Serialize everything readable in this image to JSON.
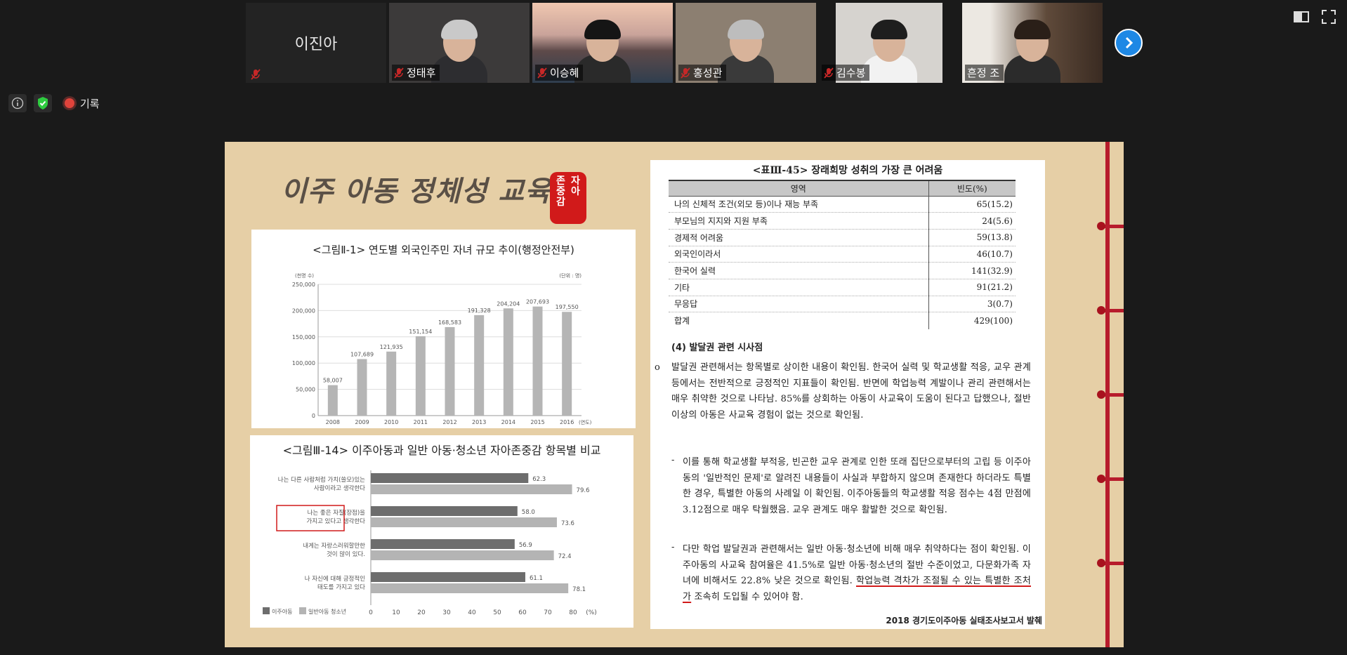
{
  "participants": [
    {
      "name": "이진아",
      "video": false,
      "muted": true
    },
    {
      "name": "정태후",
      "video": true,
      "muted": true,
      "bg": "#3c3a3a",
      "hair": "#c9c9c9"
    },
    {
      "name": "이승혜",
      "video": true,
      "muted": true,
      "bg": "#6a7a8a",
      "hair": "#151515"
    },
    {
      "name": "홍성관",
      "video": true,
      "muted": true,
      "bg": "#8c7f71",
      "hair": "#bdbdbd"
    },
    {
      "name": "김수봉",
      "video": true,
      "muted": true,
      "bg": "#d6d3cf",
      "hair": "#1e1e1e"
    },
    {
      "name": "흔정 조",
      "video": true,
      "muted": false,
      "bg": "#5f4a3a",
      "hair": "#2a1f18",
      "active": true
    }
  ],
  "status": {
    "record_label": "기록"
  },
  "slide": {
    "title": "이주 아동 정체성 교육",
    "seal_col1": [
      "존",
      "중",
      "감"
    ],
    "seal_col2": [
      "자",
      "아"
    ],
    "source": "2018 경기도이주아동 실태조사보고서 발췌"
  },
  "chart_data": [
    {
      "type": "bar",
      "title": "<그림Ⅱ-1> 연도별 외국인주민 자녀 규모 추이(행정안전부)",
      "ylabel": "(천명 수)",
      "unit_label": "(단위 : 명)",
      "xlabel": "(연도)",
      "categories": [
        "2008",
        "2009",
        "2010",
        "2011",
        "2012",
        "2013",
        "2014",
        "2015",
        "2016"
      ],
      "values": [
        58007,
        107689,
        121935,
        151154,
        168583,
        191328,
        204204,
        207693,
        197550
      ],
      "data_labels": [
        "58,007",
        "107,689",
        "121,935",
        "151,154",
        "168,583",
        "191,328",
        "204,204",
        "207,693",
        "197,550"
      ],
      "ylim": [
        0,
        250000
      ],
      "yticks": [
        "0",
        "50,000",
        "100,000",
        "150,000",
        "200,000",
        "250,000"
      ],
      "color": "#b5b5b5"
    },
    {
      "type": "bar",
      "orientation": "horizontal",
      "title": "<그림Ⅲ-14> 이주아동과 일반 아동·청소년 자아존중감 항목별 비교",
      "categories": [
        [
          "나는 다른 사람처럼 가치(쓸모)있는",
          "사람이라고 생각한다"
        ],
        [
          "나는 좋은 자질(장점)을",
          "가지고 있다고 생각한다"
        ],
        [
          "내게는 자랑스러워할만한",
          "것이 많이 있다."
        ],
        [
          "나 자신에 대해 긍정적인",
          "태도를 가지고 있다"
        ]
      ],
      "series": [
        {
          "name": "이주아동",
          "values": [
            62.3,
            58.0,
            56.9,
            61.1
          ],
          "color": "#6d6d6d"
        },
        {
          "name": "일반아동 청소년",
          "values": [
            79.6,
            73.6,
            72.4,
            78.1
          ],
          "color": "#b4b4b4"
        }
      ],
      "xlim": [
        0,
        80
      ],
      "xticks": [
        "0",
        "10",
        "20",
        "30",
        "40",
        "50",
        "60",
        "70",
        "80"
      ],
      "unit": "(%)",
      "highlighted_category": 1
    }
  ],
  "table": {
    "title": "<표Ⅲ-45> 장래희망 성취의 가장 큰 어려움",
    "headers": [
      "영역",
      "빈도(%)"
    ],
    "rows": [
      [
        "나의 신체적 조건(외모 등)이나 재능 부족",
        "65(15.2)"
      ],
      [
        "부모님의 지지와 지원 부족",
        "24(5.6)"
      ],
      [
        "경제적 어려움",
        "59(13.8)"
      ],
      [
        "외국인이라서",
        "46(10.7)"
      ],
      [
        "한국어 실력",
        "141(32.9)"
      ],
      [
        "기타",
        "91(21.2)"
      ],
      [
        "무응답",
        "3(0.7)"
      ],
      [
        "합계",
        "429(100)"
      ]
    ]
  },
  "text": {
    "section": "(4) 발달권 관련 시사점",
    "bullet": "o",
    "p1": "발달권 관련해서는 항목별로 상이한 내용이 확인됨. 한국어 실력 및 학교생활 적응, 교우 관계 등에서는 전반적으로 긍정적인 지표들이 확인됨. 반면에 학업능력 계발이나 관리 관련해서는 매우 취약한 것으로 나타남. 85%를 상회하는 아동이 사교육이 도움이 된다고 답했으나, 절반 이상의 아동은 사교육 경험이 없는 것으로 확인됨.",
    "dash": "-",
    "p2": "이를 통해 학교생활 부적응, 빈곤한 교우 관계로 인한 또래 집단으로부터의 고립 등 이주아동의 '일반적인 문제'로 알려진 내용들이 사실과 부합하지 않으며 존재한다 하더라도 특별한 경우, 특별한 아동의 사례일 이 확인됨. 이주아동들의 학교생활 적응 점수는 4점 만점에 3.12점으로 매우 탁월했음. 교우 관계도 매우 활발한 것으로 확인됨.",
    "p3_a": "다만 학업 발달권과 관련해서는 일반 아동·청소년에 비해 매우 취약하다는 점이 확인됨. 이주아동의 사교육 참여율은 41.5%로 일반 아동·청소년의 절반 수준이었고, 다문화가족 자녀에 비해서도 22.8% 낮은 것으로 확인됨. ",
    "p3_b": "학업능력 격차가 조절될 수 있는 특별한 조처가",
    "p3_c": " 조속히 도입될 수 있어야 함."
  }
}
